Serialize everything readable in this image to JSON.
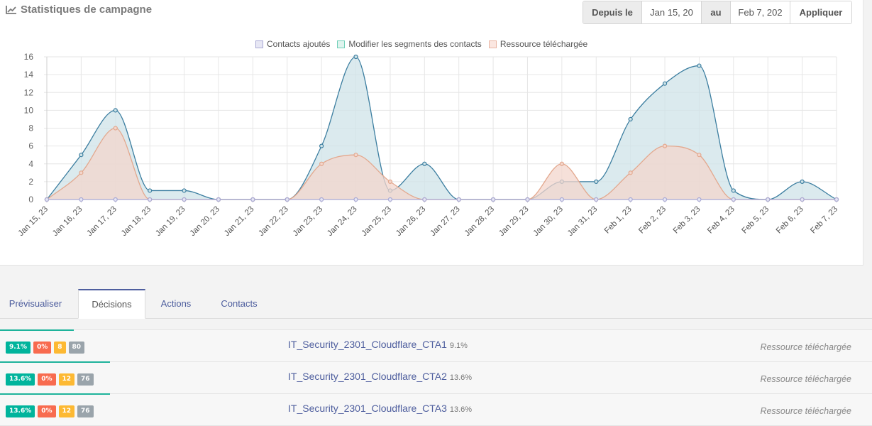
{
  "header": {
    "title": "Statistiques de campagne",
    "title_icon": "line-chart-icon"
  },
  "date_filter": {
    "from_label": "Depuis le",
    "from_value": "Jan 15, 20",
    "to_label": "au",
    "to_value": "Feb 7, 202",
    "apply_label": "Appliquer"
  },
  "chart_data": {
    "type": "area",
    "categories": [
      "Jan 15, 23",
      "Jan 16, 23",
      "Jan 17, 23",
      "Jan 18, 23",
      "Jan 19, 23",
      "Jan 20, 23",
      "Jan 21, 23",
      "Jan 22, 23",
      "Jan 23, 23",
      "Jan 24, 23",
      "Jan 25, 23",
      "Jan 26, 23",
      "Jan 27, 23",
      "Jan 28, 23",
      "Jan 29, 23",
      "Jan 30, 23",
      "Jan 31, 23",
      "Feb 1, 23",
      "Feb 2, 23",
      "Feb 3, 23",
      "Feb 4, 23",
      "Feb 5, 23",
      "Feb 6, 23",
      "Feb 7, 23"
    ],
    "ylim": [
      0,
      16
    ],
    "yticks": [
      0,
      2,
      4,
      6,
      8,
      10,
      12,
      14,
      16
    ],
    "legend_position": "top-center",
    "grid": true,
    "series": [
      {
        "name": "Contacts ajoutés",
        "color": "#a9a9d4",
        "values": [
          0,
          0,
          0,
          0,
          0,
          0,
          0,
          0,
          0,
          0,
          0,
          0,
          0,
          0,
          0,
          0,
          0,
          0,
          0,
          0,
          0,
          0,
          0,
          0
        ]
      },
      {
        "name": "Modifier les segments des contacts",
        "color": "#3c7ea0",
        "fill": "#cfe3e8",
        "values": [
          0,
          5,
          10,
          1,
          1,
          0,
          0,
          0,
          6,
          16,
          1,
          4,
          0,
          0,
          0,
          2,
          2,
          9,
          13,
          15,
          1,
          0,
          2,
          0
        ]
      },
      {
        "name": "Ressource téléchargée",
        "color": "#e3a88e",
        "fill": "#f3d6cc",
        "values": [
          0,
          3,
          8,
          0,
          0,
          0,
          0,
          0,
          4,
          5,
          2,
          0,
          0,
          0,
          0,
          4,
          0,
          3,
          6,
          5,
          0,
          0,
          0,
          0
        ]
      }
    ]
  },
  "tabs": [
    {
      "label": "Prévisualiser"
    },
    {
      "label": "Décisions"
    },
    {
      "label": "Actions"
    },
    {
      "label": "Contacts"
    }
  ],
  "decisions": [
    {
      "name": "IT_Security_2301_Cloudflare_CTA1",
      "pct": "9.1%",
      "badges": [
        "9.1%",
        "0%",
        "8",
        "80"
      ],
      "type": "Ressource téléchargée",
      "progress": 0.091
    },
    {
      "name": "IT_Security_2301_Cloudflare_CTA2",
      "pct": "13.6%",
      "badges": [
        "13.6%",
        "0%",
        "12",
        "76"
      ],
      "type": "Ressource téléchargée",
      "progress": 0.136
    },
    {
      "name": "IT_Security_2301_Cloudflare_CTA3",
      "pct": "13.6%",
      "badges": [
        "13.6%",
        "0%",
        "12",
        "76"
      ],
      "type": "Ressource téléchargée",
      "progress": 0.136
    }
  ]
}
